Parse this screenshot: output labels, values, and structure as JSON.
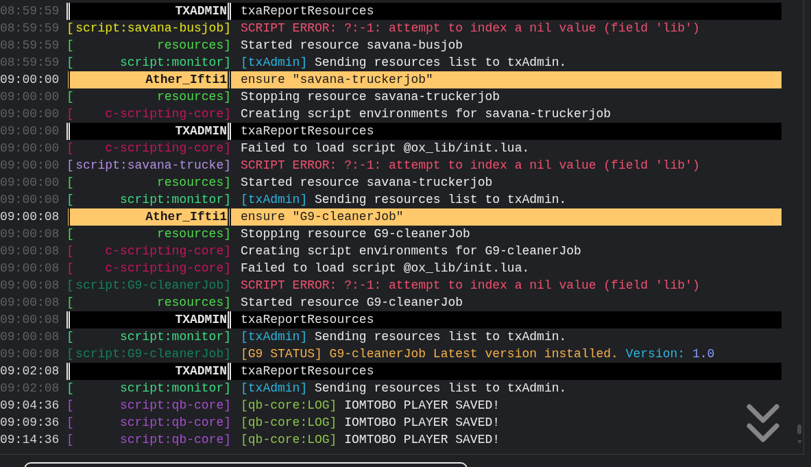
{
  "log": {
    "rows": [
      {
        "time": "08:59:59",
        "time_bright": false,
        "kind": "txadmin",
        "source": "TXADMIN",
        "message": [
          {
            "text": "txaReportResources"
          }
        ]
      },
      {
        "time": "08:59:59",
        "time_bright": false,
        "kind": "log",
        "tag": {
          "open": "[",
          "text": "script:savana-busjob]",
          "color": "#e6e619"
        },
        "message": [
          {
            "text": "SCRIPT ERROR: ?:-1: attempt to index a nil value (field 'lib')",
            "color": "#f0506e"
          }
        ]
      },
      {
        "time": "08:59:59",
        "time_bright": false,
        "kind": "log",
        "tag": {
          "open": "[",
          "text": "resources]",
          "color": "#4cdb4c"
        },
        "message": [
          {
            "text": "Started resource savana-busjob"
          }
        ]
      },
      {
        "time": "08:59:59",
        "time_bright": false,
        "kind": "log",
        "tag": {
          "open": "[",
          "text": "script:monitor]",
          "color": "#3ddc84"
        },
        "message": [
          {
            "text": "[txAdmin]",
            "color": "#2bb6e0"
          },
          {
            "text": " Sending resources list to txAdmin."
          }
        ]
      },
      {
        "time": "09:00:00",
        "time_bright": true,
        "kind": "command",
        "source": "Ather_Ifti1",
        "message": [
          {
            "text": "ensure \"savana-truckerjob\""
          }
        ]
      },
      {
        "time": "09:00:00",
        "time_bright": false,
        "kind": "log",
        "tag": {
          "open": "[",
          "text": "resources]",
          "color": "#4cdb4c"
        },
        "message": [
          {
            "text": "Stopping resource savana-truckerjob"
          }
        ]
      },
      {
        "time": "09:00:00",
        "time_bright": false,
        "kind": "log",
        "tag": {
          "open": "[",
          "text": "c-scripting-core]",
          "color": "#c8155a"
        },
        "message": [
          {
            "text": "Creating script environments for savana-truckerjob"
          }
        ]
      },
      {
        "time": "09:00:00",
        "time_bright": false,
        "kind": "txadmin",
        "source": "TXADMIN",
        "message": [
          {
            "text": "txaReportResources"
          }
        ]
      },
      {
        "time": "09:00:00",
        "time_bright": false,
        "kind": "log",
        "tag": {
          "open": "[",
          "text": "c-scripting-core]",
          "color": "#c8155a"
        },
        "message": [
          {
            "text": "Failed to load script @ox_lib/init.lua."
          }
        ]
      },
      {
        "time": "09:00:00",
        "time_bright": false,
        "kind": "log",
        "tag": {
          "open": "[",
          "text": "script:savana-trucke]",
          "color": "#b48ee0"
        },
        "message": [
          {
            "text": "SCRIPT ERROR: ?:-1: attempt to index a nil value (field 'lib')",
            "color": "#f0506e"
          }
        ]
      },
      {
        "time": "09:00:00",
        "time_bright": false,
        "kind": "log",
        "tag": {
          "open": "[",
          "text": "resources]",
          "color": "#4cdb4c"
        },
        "message": [
          {
            "text": "Started resource savana-truckerjob"
          }
        ]
      },
      {
        "time": "09:00:00",
        "time_bright": false,
        "kind": "log",
        "tag": {
          "open": "[",
          "text": "script:monitor]",
          "color": "#3ddc84"
        },
        "message": [
          {
            "text": "[txAdmin]",
            "color": "#2bb6e0"
          },
          {
            "text": " Sending resources list to txAdmin."
          }
        ]
      },
      {
        "time": "09:00:08",
        "time_bright": true,
        "kind": "command",
        "source": "Ather_Ifti1",
        "message": [
          {
            "text": "ensure \"G9-cleanerJob\""
          }
        ]
      },
      {
        "time": "09:00:08",
        "time_bright": false,
        "kind": "log",
        "tag": {
          "open": "[",
          "text": "resources]",
          "color": "#4cdb4c"
        },
        "message": [
          {
            "text": "Stopping resource G9-cleanerJob"
          }
        ]
      },
      {
        "time": "09:00:08",
        "time_bright": false,
        "kind": "log",
        "tag": {
          "open": "[",
          "text": "c-scripting-core]",
          "color": "#c8155a"
        },
        "message": [
          {
            "text": "Creating script environments for G9-cleanerJob"
          }
        ]
      },
      {
        "time": "09:00:08",
        "time_bright": false,
        "kind": "log",
        "tag": {
          "open": "[",
          "text": "c-scripting-core]",
          "color": "#c8155a"
        },
        "message": [
          {
            "text": "Failed to load script @ox_lib/init.lua."
          }
        ]
      },
      {
        "time": "09:00:08",
        "time_bright": false,
        "kind": "log",
        "tag": {
          "open": "[",
          "text": "script:G9-cleanerJob]",
          "color": "#15805e"
        },
        "message": [
          {
            "text": "SCRIPT ERROR: ?:-1: attempt to index a nil value (field 'lib')",
            "color": "#f0506e"
          }
        ]
      },
      {
        "time": "09:00:08",
        "time_bright": false,
        "kind": "log",
        "tag": {
          "open": "[",
          "text": "resources]",
          "color": "#4cdb4c"
        },
        "message": [
          {
            "text": "Started resource G9-cleanerJob"
          }
        ]
      },
      {
        "time": "09:00:08",
        "time_bright": false,
        "kind": "txadmin",
        "source": "TXADMIN",
        "message": [
          {
            "text": "txaReportResources"
          }
        ]
      },
      {
        "time": "09:00:08",
        "time_bright": false,
        "kind": "log",
        "tag": {
          "open": "[",
          "text": "script:monitor]",
          "color": "#3ddc84"
        },
        "message": [
          {
            "text": "[txAdmin]",
            "color": "#2bb6e0"
          },
          {
            "text": " Sending resources list to txAdmin."
          }
        ]
      },
      {
        "time": "09:00:08",
        "time_bright": false,
        "kind": "log",
        "tag": {
          "open": "[",
          "text": "script:G9-cleanerJob]",
          "color": "#15805e"
        },
        "message": [
          {
            "text": "[G9 STATUS] G9-cleanerJob Latest version installed.",
            "color": "#f5b14a"
          },
          {
            "text": " Version:",
            "color": "#2bb6e0"
          },
          {
            "text": " 1.0",
            "color": "#8c9cff"
          }
        ]
      },
      {
        "time": "09:02:08",
        "time_bright": true,
        "kind": "txadmin",
        "source": "TXADMIN",
        "message": [
          {
            "text": "txaReportResources"
          }
        ]
      },
      {
        "time": "09:02:08",
        "time_bright": false,
        "kind": "log",
        "tag": {
          "open": "[",
          "text": "script:monitor]",
          "color": "#3ddc84"
        },
        "message": [
          {
            "text": "[txAdmin]",
            "color": "#2bb6e0"
          },
          {
            "text": " Sending resources list to txAdmin."
          }
        ]
      },
      {
        "time": "09:04:36",
        "time_bright": true,
        "kind": "log",
        "tag": {
          "open": "[",
          "text": "script:qb-core]",
          "color": "#a54fd0"
        },
        "message": [
          {
            "text": "[qb-core:LOG]",
            "color": "#8bc34a"
          },
          {
            "text": " IOMTOBO PLAYER SAVED!"
          }
        ]
      },
      {
        "time": "09:09:36",
        "time_bright": true,
        "kind": "log",
        "tag": {
          "open": "[",
          "text": "script:qb-core]",
          "color": "#a54fd0"
        },
        "message": [
          {
            "text": "[qb-core:LOG]",
            "color": "#8bc34a"
          },
          {
            "text": " IOMTOBO PLAYER SAVED!"
          }
        ]
      },
      {
        "time": "09:14:36",
        "time_bright": true,
        "kind": "log",
        "tag": {
          "open": "[",
          "text": "script:qb-core]",
          "color": "#a54fd0"
        },
        "message": [
          {
            "text": "[qb-core:LOG]",
            "color": "#8bc34a"
          },
          {
            "text": " IOMTOBO PLAYER SAVED!"
          }
        ]
      }
    ]
  }
}
